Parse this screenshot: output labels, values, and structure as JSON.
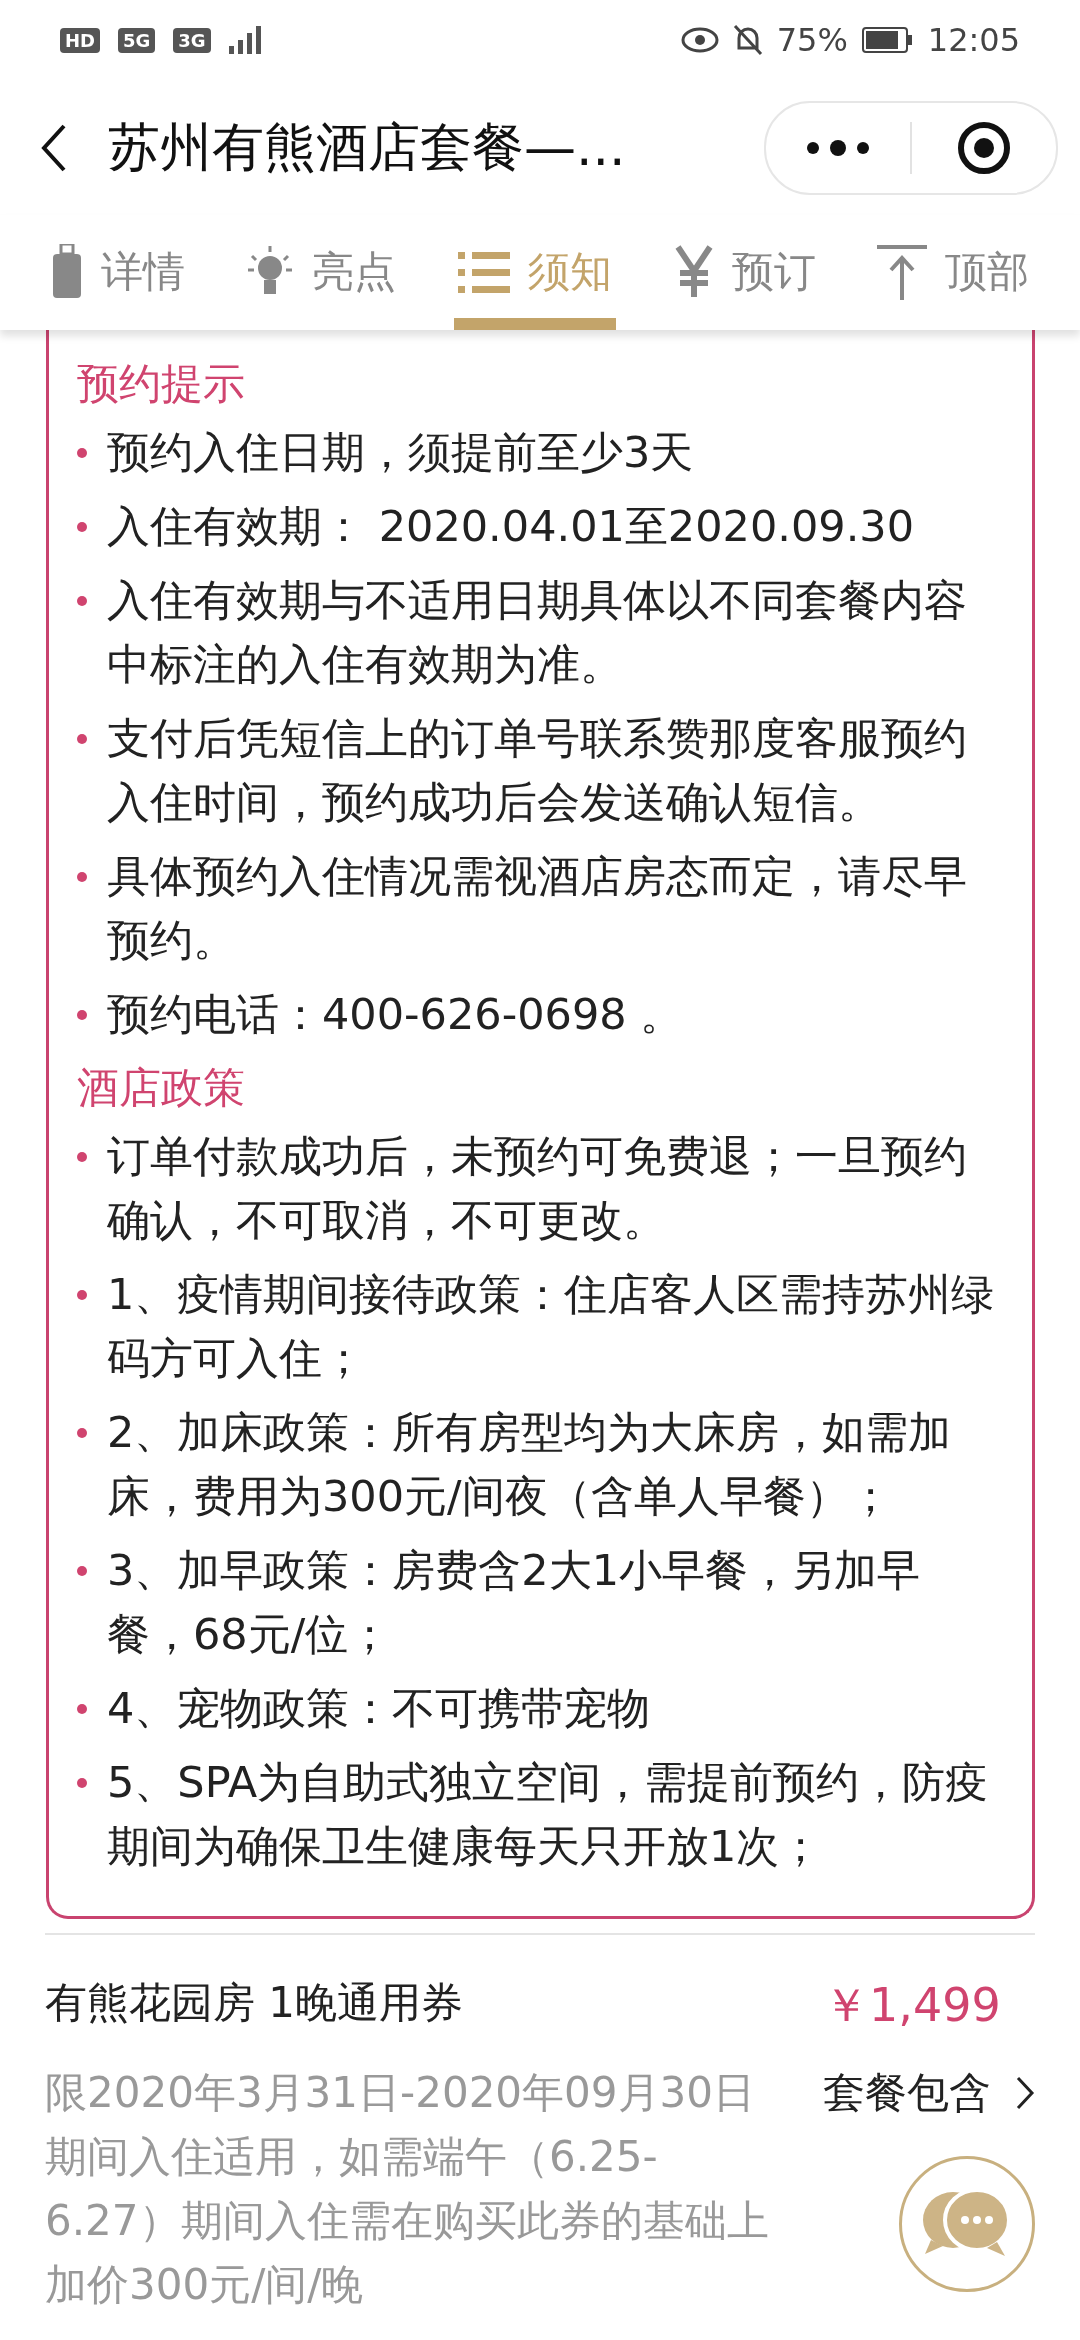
{
  "status_bar": {
    "left_badges": [
      "HD",
      "5G",
      "3G"
    ],
    "battery": "75%",
    "time": "12:05"
  },
  "header": {
    "title": "苏州有熊酒店套餐—..."
  },
  "tabs": [
    {
      "label": "详情",
      "selected": false
    },
    {
      "label": "亮点",
      "selected": false
    },
    {
      "label": "须知",
      "selected": true
    },
    {
      "label": "预订",
      "selected": false
    },
    {
      "label": "顶部",
      "selected": false
    }
  ],
  "sections": [
    {
      "title": "预约提示",
      "items": [
        "预约入住日期，须提前至少3天",
        "入住有效期： 2020.04.01至2020.09.30",
        "入住有效期与不适用日期具体以不同套餐内容中标注的入住有效期为准。",
        "支付后凭短信上的订单号联系赞那度客服预约入住时间，预约成功后会发送确认短信。",
        "具体预约入住情况需视酒店房态而定，请尽早预约。",
        "预约电话：400-626-0698 。"
      ]
    },
    {
      "title": "酒店政策",
      "items": [
        "订单付款成功后，未预约可免费退；一旦预约确认，不可取消，不可更改。",
        "1、疫情期间接待政策：住店客人区需持苏州绿码方可入住；",
        "2、加床政策：所有房型均为大床房，如需加床，费用为300元/间夜（含单人早餐）；",
        "3、加早政策：房费含2大1小早餐，另加早餐，68元/位；",
        "4、宠物政策：不可携带宠物",
        "5、SPA为自助式独立空间，需提前预约，防疫期间为确保卫生健康每天只开放1次；"
      ]
    }
  ],
  "product": {
    "name": "有熊花园房 1晚通用券",
    "price": "￥1,499",
    "description": "限2020年3月31日-2020年09月30日期间入住适用，如需端午（6.25-6.27）期间入住需在购买此券的基础上加价300元/间/晚",
    "link": "套餐包含"
  }
}
